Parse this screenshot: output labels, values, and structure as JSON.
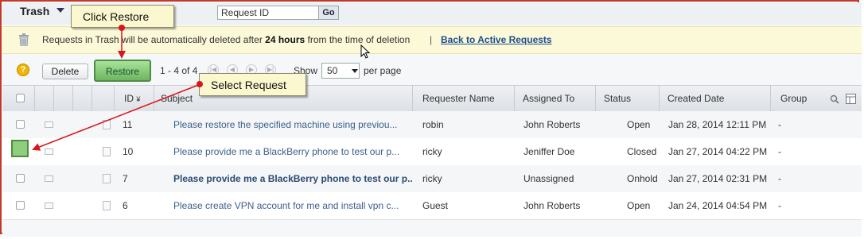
{
  "header": {
    "title": "Trash",
    "search_value": "Request ID",
    "go_label": "Go"
  },
  "notice": {
    "text_prefix": "Requests in Trash will be automatically deleted after ",
    "text_bold": "24 hours",
    "text_suffix": " from the time of deletion",
    "separator": "|",
    "back_link": "Back to Active Requests"
  },
  "toolbar": {
    "help_label": "?",
    "delete_label": "Delete",
    "restore_label": "Restore",
    "pager_range": "1 - 4 of 4",
    "show_label": "Show",
    "per_page_value": "50",
    "per_page_label": "per page"
  },
  "table": {
    "columns": {
      "id": "ID",
      "subject": "Subject",
      "requester": "Requester Name",
      "assigned": "Assigned To",
      "status": "Status",
      "created": "Created Date",
      "group": "Group"
    },
    "rows": [
      {
        "id": "11",
        "subject": "Please restore the specified machine using previou...",
        "requester": "robin",
        "assigned": "John Roberts",
        "status": "Open",
        "created": "Jan 28, 2014 12:11 PM",
        "group": "-",
        "bold": false
      },
      {
        "id": "10",
        "subject": "Please provide me a BlackBerry phone to test our p...",
        "requester": "ricky",
        "assigned": "Jeniffer Doe",
        "status": "Closed",
        "created": "Jan 27, 2014 04:22 PM",
        "group": "-",
        "bold": false
      },
      {
        "id": "7",
        "subject": "Please provide me a BlackBerry phone to test our p...",
        "requester": "ricky",
        "assigned": "Unassigned",
        "status": "Onhold",
        "created": "Jan 27, 2014 02:31 PM",
        "group": "-",
        "bold": true
      },
      {
        "id": "6",
        "subject": "Please create VPN account for me and install vpn c...",
        "requester": "Guest",
        "assigned": "John Roberts",
        "status": "Open",
        "created": "Jan 24, 2014 04:54 PM",
        "group": "-",
        "bold": false
      }
    ]
  },
  "callouts": {
    "restore": "Click Restore",
    "select": "Select Request"
  },
  "colors": {
    "accent_green": "#6fb55f",
    "callout_bg": "#fbf7cf",
    "marker_red": "#d8161b",
    "link_blue": "#1d4e8f"
  }
}
